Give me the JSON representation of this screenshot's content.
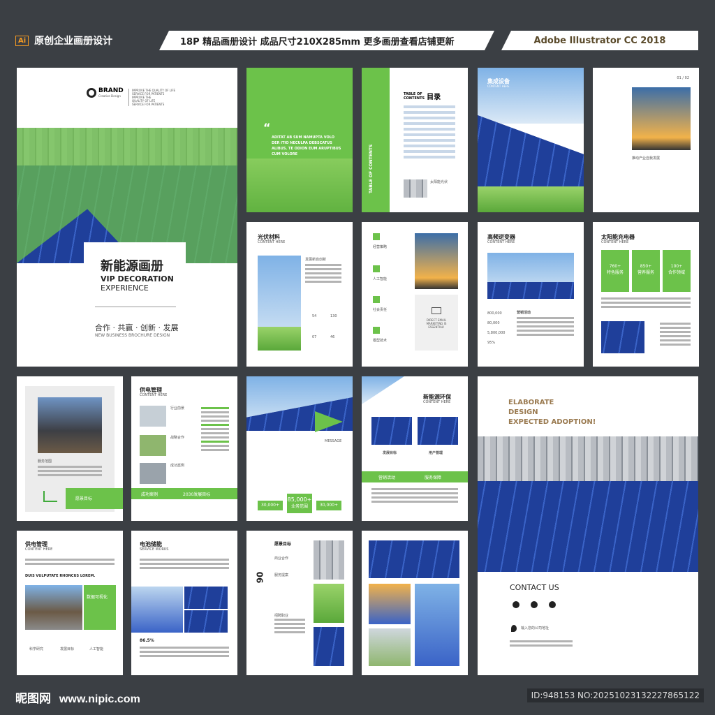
{
  "header": {
    "ai_badge": "Ai",
    "left_title": "原创企业画册设计",
    "center_title": "18P 精品画册设计  成品尺寸210X285mm  更多画册查看店铺更新",
    "right_title": "Adobe Illustrator CC 2018"
  },
  "cover": {
    "brand": "BRAND",
    "brand_sub": "Creative Design",
    "tag1": "IMPROVE THE QUALITY OF LIFE",
    "tag2": "SERVICE FOR PATIENTS",
    "tag3": "IMPROVE THE",
    "tag4": "QUALITY OF LIFE",
    "tag5": "SERVICE FOR PATIENTS",
    "title_cn": "新能源画册",
    "title_en1": "VIP DECORATION",
    "title_en2": "EXPERIENCE",
    "slogan": "合作 · 共赢 · 创新 · 发展",
    "slogan_en": "NEW BUSINESS  BROCHURE DESIGN"
  },
  "p2": {
    "quote": "ADITAT AB SUM NAMUPTA VOLO DER ITIO NECULPA DEBSCATUS ALIBUS. TE ODION EUM ARUPTIBUS CUM VOLORE"
  },
  "p3": {
    "vertical": "TABLE OF CONTENTS",
    "toc_en": "TABLE OF CONTENTS",
    "toc_cn": "目录",
    "item_label": "太阳能光伏"
  },
  "p4": {
    "title": "集成设备",
    "sub": "CONTENT HERE"
  },
  "p5": {
    "page_no": "01 / 02",
    "caption": "推动产业自我发展"
  },
  "p6": {
    "title": "光伏材料",
    "sub": "CONTENT HERE",
    "section": "发展新自创新",
    "stats": [
      "54",
      "130",
      "07",
      "46"
    ]
  },
  "p7": {
    "labels": [
      "经营策略",
      "人工智能",
      "社会责任",
      "模型技术"
    ],
    "email": "DIRECT EMAIL MARKETING IS ESSENTIAL!"
  },
  "p8": {
    "title": "高频逆变器",
    "sub": "CONTENT HERE",
    "sec": "营销活动",
    "stats": [
      "800,000",
      "80,000",
      "5,800,000",
      "95%"
    ]
  },
  "p9": {
    "title": "太阳能充电器",
    "sub": "CONTENT HERE",
    "boxes": [
      "760+",
      "850+",
      "100+"
    ],
    "box_labels": [
      "特色服务",
      "营养服务",
      "合作领域"
    ]
  },
  "p10": {
    "caption": "服务范围",
    "btn": "愿景目标"
  },
  "p11": {
    "title": "供电管理",
    "sub": "CONTENT HERE",
    "items": [
      "行业前景",
      "战略合作",
      "成功案例"
    ],
    "bar1": "成功案例",
    "bar2": "2030发展目标"
  },
  "p12": {
    "message": "MESSAGE",
    "stats": [
      "30,000+",
      "85,000+",
      "30,000+"
    ],
    "center_label": "业务范围"
  },
  "p13": {
    "title": "新能源环保",
    "sub": "CONTENT HERE",
    "labels": [
      "发展目标",
      "用户管理",
      "营销活动",
      "服务保障"
    ]
  },
  "p14": {
    "line1": "ELABORATE",
    "line2": "DESIGN",
    "line3": "EXPECTED ADOPTION!",
    "contact": "CONTACT US",
    "address": "输入您的公司地址"
  },
  "p15": {
    "title": "供电管理",
    "sub": "CONTENT HERE",
    "headline": "DUIS VULPUTATE RHONCUS LOREM.",
    "badge": "数据可视化",
    "icons": [
      "科学研究",
      "发展目标",
      "人工智能"
    ]
  },
  "p16": {
    "title": "电池储能",
    "sub": "SERVICE WORKS",
    "stat": "86.5%"
  },
  "p17": {
    "number": "06",
    "title": "愿景目标",
    "sub1": "商业合作",
    "sub2": "服务提案",
    "sub3": "招聘职业"
  },
  "footer": {
    "logo": "昵图网",
    "url": "www.nipic.com",
    "id": "ID:948153 NO:20251023132227865122"
  },
  "colors": {
    "accent": "#6cc24a",
    "dark": "#3b3f44",
    "panel": "#1f3f9a"
  }
}
